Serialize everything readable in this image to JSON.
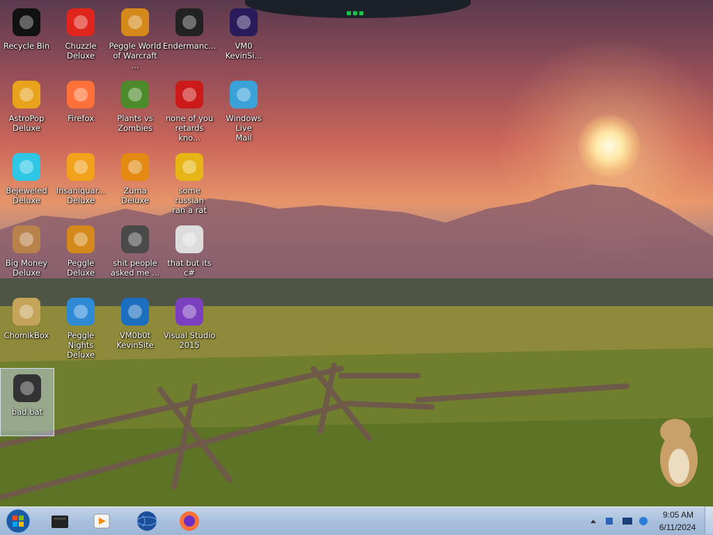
{
  "desktop": {
    "icons": [
      {
        "label": "Recycle Bin",
        "icon": "recycle-bin-icon",
        "color": "#111111"
      },
      {
        "label": "Chuzzle\nDeluxe",
        "icon": "chuzzle-icon",
        "color": "#e0251c"
      },
      {
        "label": "Peggle World\nof Warcraft ...",
        "icon": "peggle-icon",
        "color": "#d4891a"
      },
      {
        "label": "Endermanc...",
        "icon": "terminal-icon",
        "color": "#222222"
      },
      {
        "label": "VM0\nKevinSi...",
        "icon": "firefox-file-icon",
        "color": "#2a1b5c"
      },
      {
        "label": "AstroPop\nDeluxe",
        "icon": "astropop-icon",
        "color": "#e8a21c"
      },
      {
        "label": "Firefox",
        "icon": "firefox-icon",
        "color": "#ff7139"
      },
      {
        "label": "Plants vs\nZombies",
        "icon": "pvz-icon",
        "color": "#4c8a2c"
      },
      {
        "label": "none of you\nretards kno...",
        "icon": "red-logo-icon",
        "color": "#cc1a1a"
      },
      {
        "label": "Windows Live\nMail",
        "icon": "mail-icon",
        "color": "#3aa2d8"
      },
      {
        "label": "Bejeweled\nDeluxe",
        "icon": "gem-icon",
        "color": "#2fc7e6"
      },
      {
        "label": "Insaniquar...\nDeluxe",
        "icon": "fish-icon",
        "color": "#f2a11a"
      },
      {
        "label": "Zuma Deluxe",
        "icon": "zuma-icon",
        "color": "#e48a12"
      },
      {
        "label": "some russian\nran a rat",
        "icon": "de-icon",
        "color": "#e8b516"
      },
      {
        "label": "Big Money\nDeluxe",
        "icon": "money-bag-icon",
        "color": "#b9824a"
      },
      {
        "label": "Peggle Deluxe",
        "icon": "peggle-icon",
        "color": "#d4891a"
      },
      {
        "label": "shit people\nasked me ...",
        "icon": "folder-icon",
        "color": "#4a4a4a"
      },
      {
        "label": "that but its c#",
        "icon": "windows-stack-icon",
        "color": "#dddddd"
      },
      {
        "label": "ChomikBox",
        "icon": "hamster-box-icon",
        "color": "#c4a35a"
      },
      {
        "label": "Peggle Nights\nDeluxe",
        "icon": "peggle-nights-icon",
        "color": "#2f8ad6"
      },
      {
        "label": "VM0b0t\nKevinSite",
        "icon": "vm-icon",
        "color": "#1c6fbf"
      },
      {
        "label": "Visual Studio\n2015",
        "icon": "vs-icon",
        "color": "#7b3fbf"
      },
      {
        "label": "bad.bat",
        "icon": "batch-file-icon",
        "color": "#333333"
      }
    ]
  },
  "taskbar": {
    "start_icon": "windows-start-icon",
    "pinned": [
      {
        "name": "taskbar-console",
        "icon": "console-icon",
        "color": "#222222"
      },
      {
        "name": "taskbar-media-player",
        "icon": "media-player-icon",
        "color": "#f08a1a"
      },
      {
        "name": "taskbar-globe",
        "icon": "globe-icon",
        "color": "#1d4e9a"
      },
      {
        "name": "taskbar-firefox",
        "icon": "firefox-icon",
        "color": "#ff7139"
      }
    ],
    "clock": {
      "time": "9:05 AM",
      "date": "6/11/2024"
    },
    "tray_icons": [
      "show-hidden-icon",
      "network-icon",
      "display-icon",
      "ie-icon"
    ]
  },
  "colors": {
    "taskbar": "#a9c0dc",
    "selection": "#c8dcff"
  }
}
